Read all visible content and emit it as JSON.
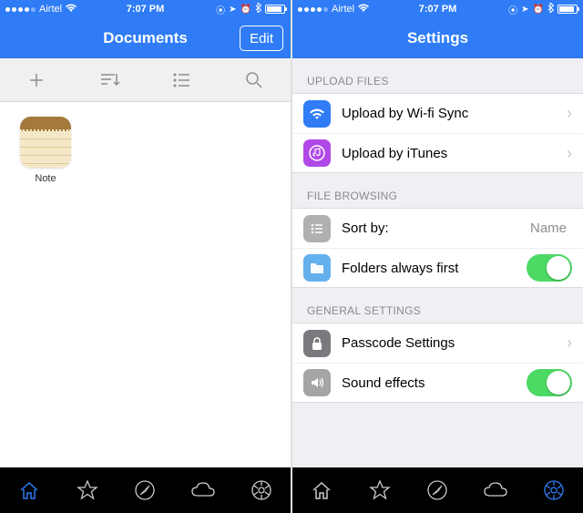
{
  "status": {
    "carrier": "Airtel",
    "signal_active": 4,
    "wifi": "wifi-icon",
    "time": "7:07 PM",
    "indicators": [
      "location",
      "nav",
      "alarm",
      "bluetooth"
    ],
    "battery_pct": 90
  },
  "left": {
    "title": "Documents",
    "edit_label": "Edit",
    "toolbar": [
      "add",
      "sort",
      "list",
      "search"
    ],
    "files": [
      {
        "name": "Note",
        "icon": "note-icon"
      }
    ],
    "tabs": [
      "home",
      "star",
      "safari",
      "cloud",
      "settings"
    ],
    "active_tab": 0
  },
  "right": {
    "title": "Settings",
    "sections": [
      {
        "header": "UPLOAD FILES",
        "rows": [
          {
            "icon": "wifi-sync-icon",
            "icon_class": "ic-wifi",
            "label": "Upload by Wi-fi Sync",
            "acc": "chev"
          },
          {
            "icon": "itunes-icon",
            "icon_class": "ic-itunes",
            "label": "Upload by iTunes",
            "acc": "chev"
          }
        ]
      },
      {
        "header": "FILE BROWSING",
        "rows": [
          {
            "icon": "list-icon",
            "icon_class": "ic-sort",
            "label": "Sort by:",
            "value": "Name"
          },
          {
            "icon": "folder-icon",
            "icon_class": "ic-folder",
            "label": "Folders always first",
            "toggle": true
          }
        ]
      },
      {
        "header": "GENERAL SETTINGS",
        "rows": [
          {
            "icon": "lock-icon",
            "icon_class": "ic-lock",
            "label": "Passcode Settings",
            "acc": "chev"
          },
          {
            "icon": "sound-icon",
            "icon_class": "ic-sound",
            "label": "Sound effects",
            "toggle": true
          }
        ]
      }
    ],
    "tabs": [
      "home",
      "star",
      "safari",
      "cloud",
      "settings"
    ],
    "active_tab": 4
  }
}
